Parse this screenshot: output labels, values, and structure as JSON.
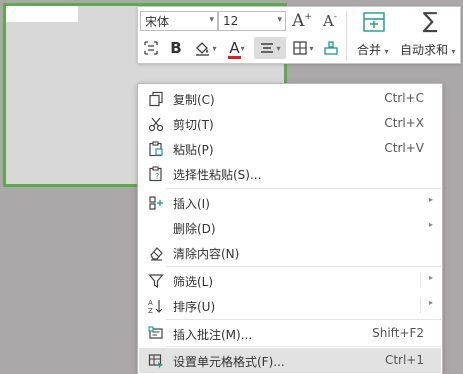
{
  "toolbar": {
    "font_name": "宋体",
    "font_size": "12",
    "increase_font": "A",
    "decrease_font": "A",
    "merge_label": "合并",
    "autosum_label": "自动求和",
    "bold_label": "B",
    "font_color_letter": "A"
  },
  "colors": {
    "cell_border": "#5cab4c",
    "font_color_underline": "#e02020",
    "highlight_row": "#e2e2e2",
    "icon_teal": "#1d9b89"
  },
  "menu": {
    "items": [
      {
        "label": "复制(C)",
        "shortcut": "Ctrl+C",
        "icon": "copy-icon"
      },
      {
        "label": "剪切(T)",
        "shortcut": "Ctrl+X",
        "icon": "scissors-icon"
      },
      {
        "label": "粘贴(P)",
        "shortcut": "Ctrl+V",
        "icon": "paste-icon"
      },
      {
        "label": "选择性粘贴(S)...",
        "shortcut": "",
        "icon": "paste-special-icon"
      },
      {
        "label": "插入(I)",
        "shortcut": "",
        "icon": "insert-icon"
      },
      {
        "label": "删除(D)",
        "shortcut": "",
        "icon": ""
      },
      {
        "label": "清除内容(N)",
        "shortcut": "",
        "icon": "eraser-icon"
      },
      {
        "label": "筛选(L)",
        "shortcut": "",
        "icon": "filter-icon"
      },
      {
        "label": "排序(U)",
        "shortcut": "",
        "icon": "sort-az-icon"
      },
      {
        "label": "插入批注(M)...",
        "shortcut": "Shift+F2",
        "icon": "comment-icon"
      },
      {
        "label": "设置单元格格式(F)...",
        "shortcut": "Ctrl+1",
        "icon": "format-cells-icon"
      }
    ]
  }
}
